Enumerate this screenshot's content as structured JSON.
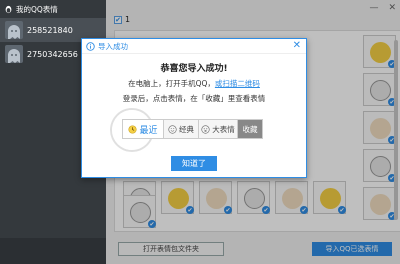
{
  "left": {
    "title": "我的QQ表情",
    "accounts": [
      {
        "id": "258521840",
        "selected": true
      },
      {
        "id": "2750342656",
        "selected": false
      }
    ]
  },
  "main": {
    "window_controls": [
      "—",
      "✕"
    ],
    "select_count": "1",
    "open_folder_label": "打开表情包文件夹",
    "import_label": "导入QQ已选表情"
  },
  "dialog": {
    "title": "导入成功",
    "close": "✕",
    "heading": "恭喜您导入成功!",
    "line1_prefix": "在电脑上，打开手机QQ，",
    "line1_link": "或扫描二维码",
    "line2": "登录后，点击表情，在「收藏」里查看表情",
    "tabs": [
      {
        "label": "最近",
        "icon": "clock-icon",
        "active": true
      },
      {
        "label": "经典",
        "icon": "smile-icon",
        "active": false
      },
      {
        "label": "大表情",
        "icon": "big-emoji-icon",
        "active": false
      },
      {
        "label": "收藏",
        "icon": "",
        "active": false
      }
    ],
    "ok_label": "知道了"
  },
  "colors": {
    "accent": "#2f8de4",
    "left_bg": "#34393d"
  }
}
